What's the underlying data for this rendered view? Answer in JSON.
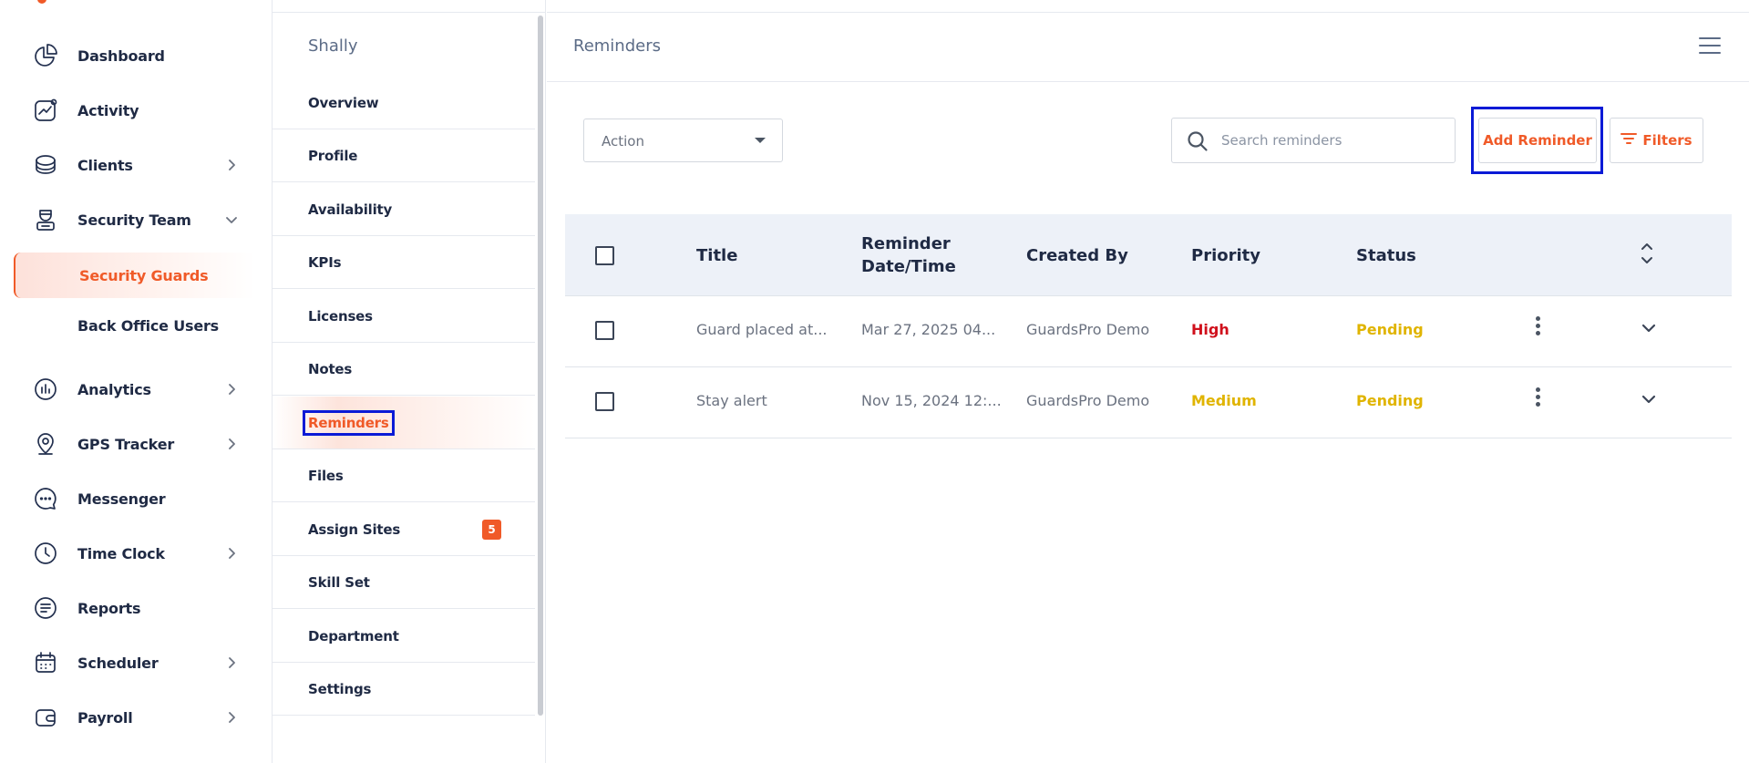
{
  "sidebar": {
    "items": [
      {
        "label": "Dashboard",
        "icon": "pie-chart-icon"
      },
      {
        "label": "Activity",
        "icon": "activity-chart-icon"
      },
      {
        "label": "Clients",
        "icon": "clients-icon"
      },
      {
        "label": "Security Team",
        "icon": "security-team-icon"
      },
      {
        "label": "Security Guards"
      },
      {
        "label": "Back Office Users"
      },
      {
        "label": "Analytics",
        "icon": "analytics-icon"
      },
      {
        "label": "GPS Tracker",
        "icon": "location-pin-icon"
      },
      {
        "label": "Messenger",
        "icon": "chat-bubble-icon"
      },
      {
        "label": "Time Clock",
        "icon": "clock-icon"
      },
      {
        "label": "Reports",
        "icon": "reports-icon"
      },
      {
        "label": "Scheduler",
        "icon": "calendar-icon"
      },
      {
        "label": "Payroll",
        "icon": "wallet-icon"
      }
    ]
  },
  "profile_menu": {
    "name": "Shally",
    "items": [
      {
        "label": "Overview"
      },
      {
        "label": "Profile"
      },
      {
        "label": "Availability"
      },
      {
        "label": "KPIs"
      },
      {
        "label": "Licenses"
      },
      {
        "label": "Notes"
      },
      {
        "label": "Reminders"
      },
      {
        "label": "Files"
      },
      {
        "label": "Assign Sites",
        "badge": "5"
      },
      {
        "label": "Skill Set"
      },
      {
        "label": "Department"
      },
      {
        "label": "Settings"
      }
    ]
  },
  "main": {
    "title": "Reminders",
    "action_select": "Action",
    "search_placeholder": "Search reminders",
    "add_button": "Add Reminder",
    "filters_button": "Filters"
  },
  "table": {
    "headers": {
      "title": "Title",
      "reminder_line1": "Reminder",
      "reminder_line2": "Date/Time",
      "created_by": "Created By",
      "priority": "Priority",
      "status": "Status"
    },
    "rows": [
      {
        "title": "Guard placed at...",
        "datetime": "Mar 27, 2025 04...",
        "created_by": "GuardsPro Demo",
        "priority": "High",
        "status": "Pending"
      },
      {
        "title": "Stay alert",
        "datetime": "Nov 15, 2024 12:...",
        "created_by": "GuardsPro Demo",
        "priority": "Medium",
        "status": "Pending"
      }
    ]
  },
  "colors": {
    "accent": "#f05a28",
    "priority_high": "#d0101c",
    "pending": "#e0b400",
    "highlight_box": "#0a1ad6"
  }
}
